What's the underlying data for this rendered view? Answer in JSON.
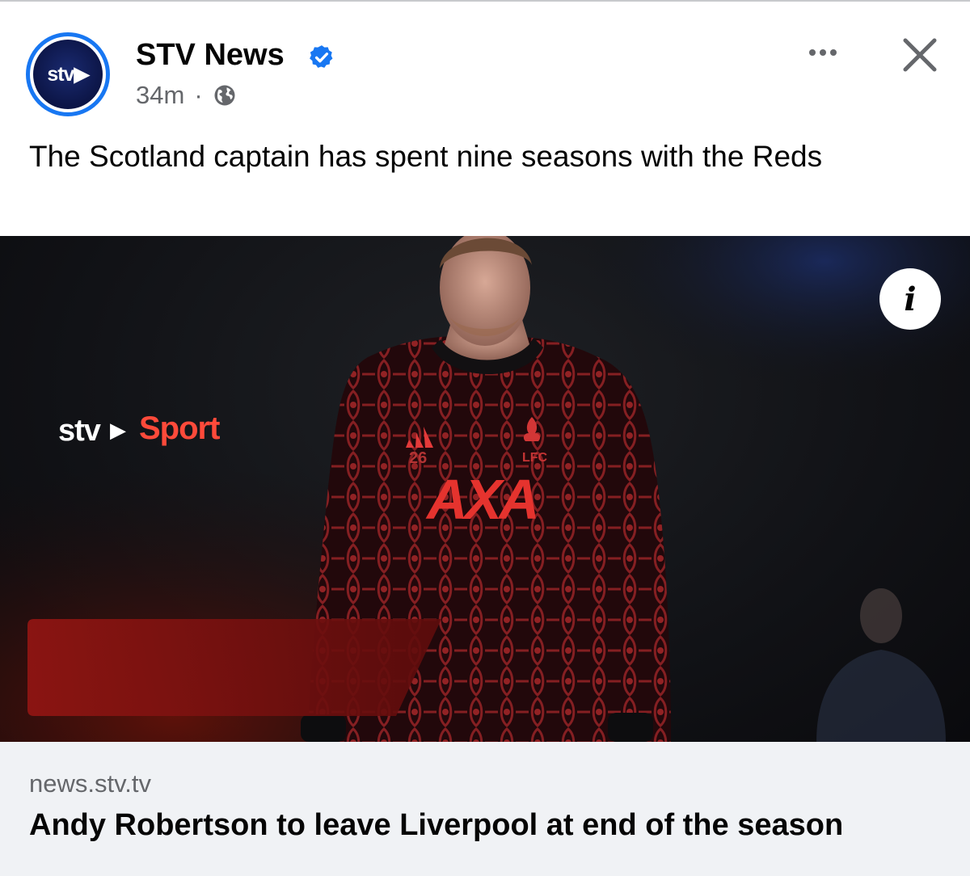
{
  "post": {
    "author": "STV News",
    "avatar_text": "stv",
    "timestamp": "34m",
    "separator": "·",
    "audience_icon": "globe-icon",
    "verified_icon": "verified-badge-icon",
    "text": "The Scotland captain has spent nine seasons with the Reds"
  },
  "media": {
    "info_label": "i",
    "overlay_brand": "stv",
    "overlay_label": "Sport",
    "kit_number": "26",
    "sponsor": "AXA",
    "crest_text": "LFC"
  },
  "link": {
    "domain": "news.stv.tv",
    "headline": "Andy Robertson to leave Liverpool at end of the season"
  },
  "colors": {
    "verified": "#1877f2",
    "secondary_text": "#65676b",
    "link_background": "#f0f2f5",
    "sport_red": "#ff4a3a"
  }
}
